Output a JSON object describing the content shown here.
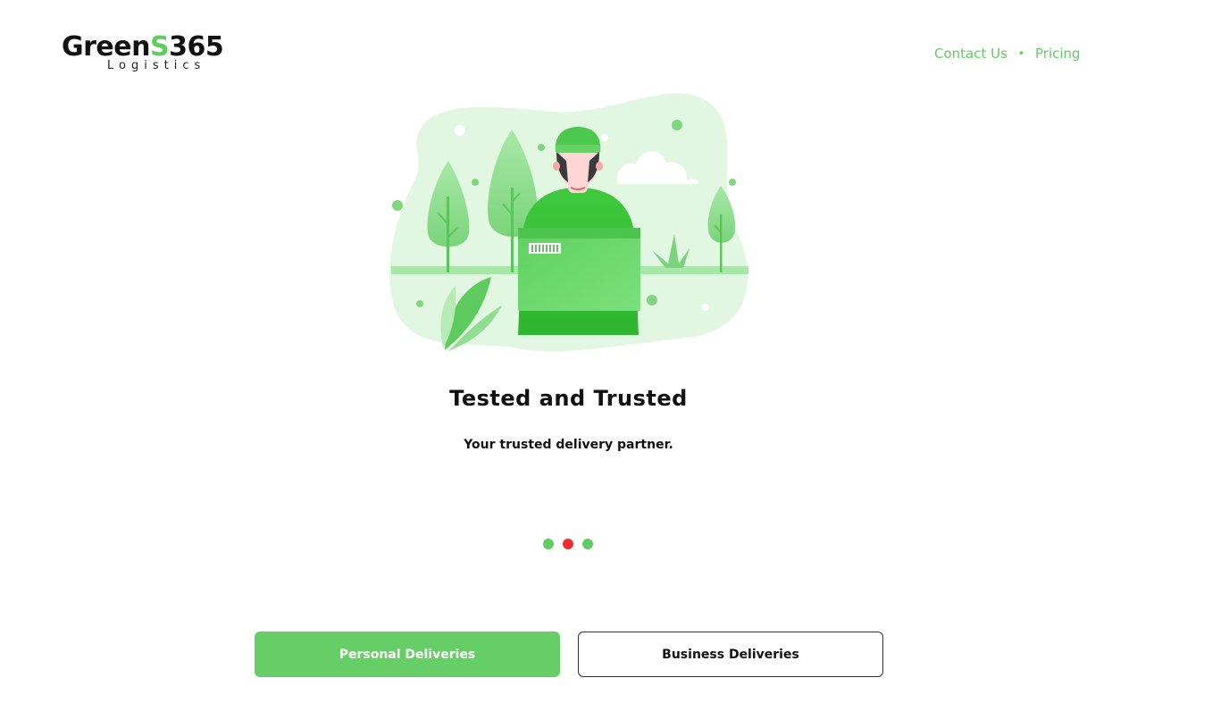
{
  "brand": {
    "name_part1": "Green",
    "name_part2": "S",
    "name_part3": "365",
    "tagline": "Logistics",
    "accent_color": "#62cc62"
  },
  "nav": {
    "contact_label": "Contact Us",
    "separator": "•",
    "pricing_label": "Pricing"
  },
  "hero": {
    "illustration": "delivery-person-with-box",
    "title": "Tested and Trusted",
    "subtitle": "Your trusted delivery partner."
  },
  "carousel": {
    "slide_count": 3,
    "active_index": 1,
    "active_color": "#ef2d2d",
    "inactive_color": "#62cc62"
  },
  "actions": {
    "personal_label": "Personal Deliveries",
    "business_label": "Business Deliveries"
  }
}
